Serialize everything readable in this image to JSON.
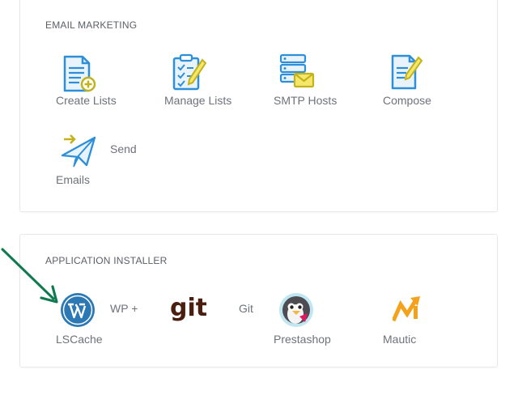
{
  "email_marketing": {
    "title": "EMAIL MARKETING",
    "items": [
      {
        "label": "Create Lists",
        "icon": "create-list-icon"
      },
      {
        "label": "Manage Lists",
        "icon": "manage-list-icon"
      },
      {
        "label": "SMTP Hosts",
        "icon": "smtp-host-icon"
      },
      {
        "label": "Compose",
        "icon": "compose-icon"
      },
      {
        "label_line1": "Send",
        "label_line2": "Emails",
        "icon": "send-email-icon"
      }
    ]
  },
  "application_installer": {
    "title": "APPLICATION INSTALLER",
    "items": [
      {
        "label_line1": "WP +",
        "label_line2": "LSCache",
        "icon": "wordpress-icon"
      },
      {
        "label_line1": "Git",
        "icon": "git-icon"
      },
      {
        "label": "Prestashop",
        "icon": "prestashop-icon"
      },
      {
        "label": "Mautic",
        "icon": "mautic-icon"
      }
    ]
  },
  "colors": {
    "accent_blue": "#2e8fd9",
    "accent_yellow": "#c3b21a",
    "annotation_arrow": "#0f7a4f",
    "git_brown": "#4a1f10",
    "mautic_orange": "#f4a11c"
  }
}
